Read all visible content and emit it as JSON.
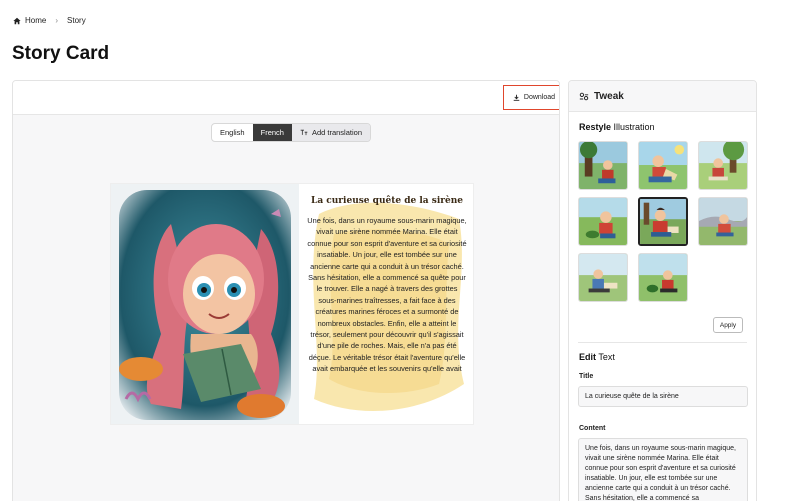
{
  "breadcrumb": {
    "home": "Home",
    "current": "Story"
  },
  "page": {
    "title": "Story Card"
  },
  "toolbar": {
    "download_label": "Download"
  },
  "languages": {
    "tabs": [
      "English",
      "French"
    ],
    "active": "French",
    "add_label": "Add translation"
  },
  "story": {
    "title": "La curieuse quête de la sirène",
    "body": "Une fois, dans un royaume sous-marin magique, vivait une sirène nommée Marina. Elle était connue pour son esprit d'aventure et sa curiosité insatiable. Un jour, elle est tombée sur une ancienne carte qui a conduit à un trésor caché. Sans hésitation, elle a commencé sa quête pour le trouver. Elle a nagé à travers des grottes sous-marines traîtresses, a fait face à des créatures marines féroces et a surmonté de nombreux obstacles. Enfin, elle a atteint le trésor, seulement pour découvrir qu'il s'agissait d'une pile de roches. Mais, elle n'a pas été déçue. Le véritable trésor était l'aventure qu'elle avait embarquée et les souvenirs qu'elle avait"
  },
  "tweak": {
    "header": "Tweak",
    "restyle_bold": "Restyle",
    "restyle_rest": "Illustration",
    "thumbnails_count": 8,
    "selected_thumbnail": 5,
    "apply_label": "Apply",
    "edit_bold": "Edit",
    "edit_rest": "Text",
    "title_label": "Title",
    "title_value": "La curieuse quête de la sirène",
    "content_label": "Content",
    "content_value": "Une fois, dans un royaume sous-marin magique, vivait une sirène nommée Marina. Elle était connue pour son esprit d'aventure et sa curiosité insatiable. Un jour, elle est tombée sur une ancienne carte qui a conduit à un trésor caché. Sans hésitation, elle a commencé sa"
  },
  "colors": {
    "accent_border": "#e0462c",
    "active_tab": "#3a3a3a",
    "panel_bg": "#f7f7f8"
  },
  "icons": {
    "home": "home-icon",
    "breadcrumb_sep": "chevron-right-icon",
    "download": "download-icon",
    "translate": "text-translate-icon",
    "tweak": "tweak-icon"
  }
}
